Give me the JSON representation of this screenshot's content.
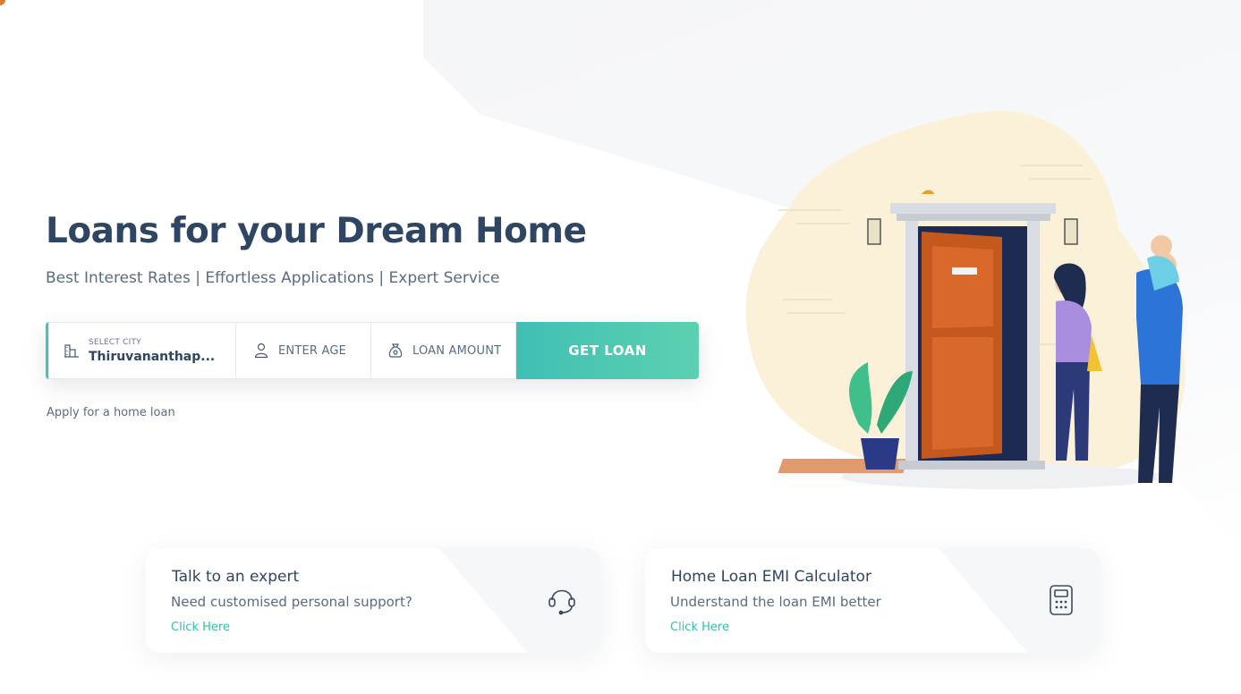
{
  "hero": {
    "title": "Loans for your Dream Home",
    "subtitle": "Best Interest Rates | Effortless Applications | Expert Service"
  },
  "search": {
    "city_label": "SELECT CITY",
    "city_value": "Thiruvananthap...",
    "age_placeholder": "ENTER AGE",
    "amount_placeholder": "LOAN AMOUNT",
    "submit_label": "GET LOAN"
  },
  "apply_link": "Apply for a home loan",
  "cards": [
    {
      "title": "Talk to an expert",
      "description": "Need customised personal support?",
      "link": "Click Here",
      "icon": "headset-icon"
    },
    {
      "title": "Home Loan EMI Calculator",
      "description": "Understand the loan EMI better",
      "link": "Click Here",
      "icon": "calculator-icon"
    }
  ],
  "colors": {
    "accent": "#45c3b3",
    "title": "#2e4564",
    "text": "#5b6b82",
    "link": "#2fc0ac"
  }
}
